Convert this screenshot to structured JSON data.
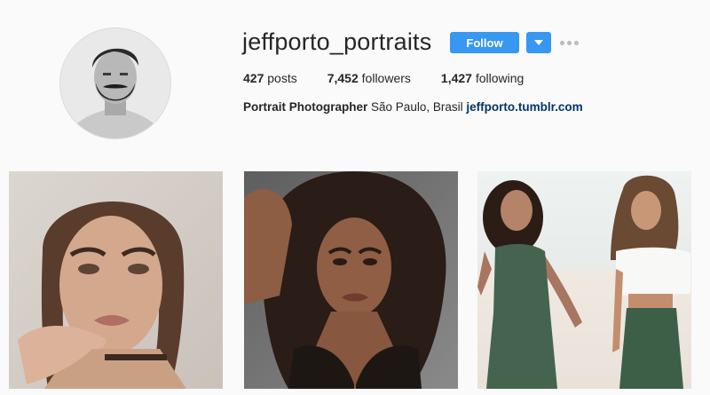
{
  "profile": {
    "username": "jeffporto_portraits",
    "follow_label": "Follow",
    "stats": {
      "posts_count": "427",
      "posts_label": "posts",
      "followers_count": "7,452",
      "followers_label": "followers",
      "following_count": "1,427",
      "following_label": "following"
    },
    "bio": {
      "name": "Portrait Photographer",
      "text": "São Paulo, Brasil",
      "link": "jeffporto.tumblr.com"
    }
  },
  "colors": {
    "accent": "#3897f0",
    "link": "#003569",
    "background": "#fafafa"
  },
  "icons": {
    "dropdown": "chevron-down-icon",
    "more": "more-options-icon"
  }
}
